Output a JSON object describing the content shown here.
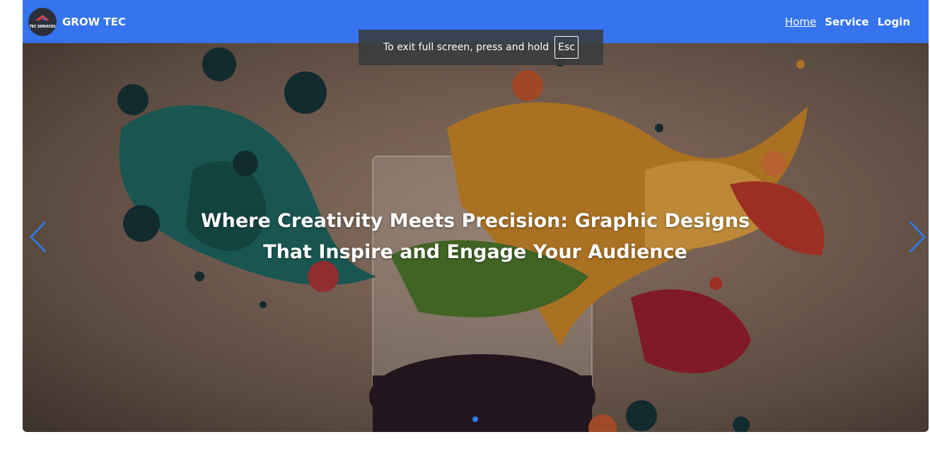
{
  "brand": {
    "logo_text": "TEC SERVICES",
    "name": "GROW TEC"
  },
  "nav": {
    "items": [
      {
        "label": "Home",
        "active": true
      },
      {
        "label": "Service",
        "active": false
      },
      {
        "label": "Login",
        "active": false
      }
    ]
  },
  "hero": {
    "caption": "Where Creativity Meets Precision: Graphic Designs That Inspire and Engage Your Audience",
    "prev_icon": "chevron-left-icon",
    "next_icon": "chevron-right-icon",
    "active_slide": 1,
    "slide_count": 1
  },
  "fullscreen_notice": {
    "text": "To exit full screen, press and hold",
    "key": "Esc"
  },
  "colors": {
    "navbar": "#3574ee",
    "arrow": "#2f7cf6",
    "indicator": "#2f7cf6"
  }
}
